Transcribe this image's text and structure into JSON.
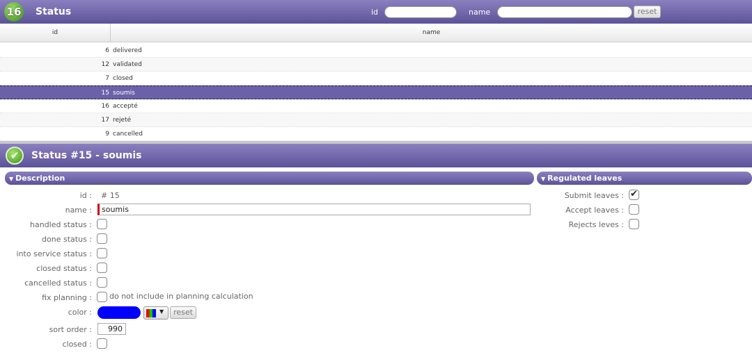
{
  "top": {
    "count": "16",
    "title": "Status",
    "id_label": "id",
    "name_label": "name",
    "reset_label": "reset",
    "id_value": "",
    "name_value": ""
  },
  "grid": {
    "headers": {
      "id": "id",
      "name": "name"
    },
    "rows": [
      {
        "id": "6",
        "name": "delivered"
      },
      {
        "id": "12",
        "name": "validated"
      },
      {
        "id": "7",
        "name": "closed"
      },
      {
        "id": "15",
        "name": "soumis"
      },
      {
        "id": "16",
        "name": "accepté"
      },
      {
        "id": "17",
        "name": "rejeté"
      },
      {
        "id": "9",
        "name": "cancelled"
      }
    ],
    "selected_index": 3
  },
  "detail": {
    "title": "Status  #15 - soumis",
    "description_header": "Description",
    "regulated_header": "Regulated leaves",
    "fields": {
      "id_label": "id :",
      "id_value": "#  15",
      "name_label": "name :",
      "name_value": "soumis",
      "handled_label": "handled status :",
      "done_label": "done status :",
      "into_service_label": "into service status :",
      "closed_status_label": "closed status :",
      "cancelled_label": "cancelled status :",
      "fix_planning_label": "fix planning :",
      "fix_planning_hint": "do not include in planning calculation",
      "color_label": "color :",
      "color_value": "#0000ff",
      "color_reset": "reset",
      "sort_order_label": "sort order :",
      "sort_order_value": "990",
      "closed_label": "closed :"
    },
    "leaves": {
      "submit_label": "Submit leaves :",
      "accept_label": "Accept leaves :",
      "reject_label": "Rejects leves :",
      "submit_checked": true
    }
  },
  "colors": {
    "header_bar": "#6a62a8",
    "accent_green": "#3b8a1a",
    "name_marker": "#d00000"
  }
}
